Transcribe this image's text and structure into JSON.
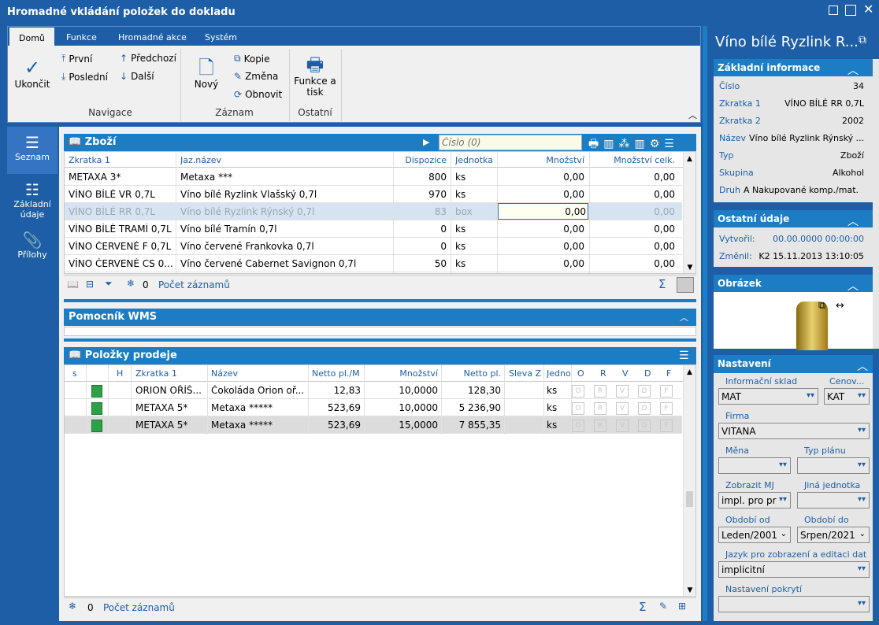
{
  "window": {
    "title": "Hromadné vkládání položek do dokladu"
  },
  "ribbon": {
    "tabs": [
      "Domů",
      "Funkce",
      "Hromadné akce",
      "Systém"
    ],
    "ukoncit": "Ukončit",
    "prvni": "První",
    "posledni": "Poslední",
    "predchozi": "Předchozí",
    "dalsi": "Další",
    "novy": "Nový",
    "kopie": "Kopie",
    "zmena": "Změna",
    "obnovit": "Obnovit",
    "funkce_tisk_1": "Funkce a",
    "funkce_tisk_2": "tisk",
    "groups": {
      "navigace": "Navigace",
      "zaznam": "Záznam",
      "ostatni": "Ostatní"
    }
  },
  "sidebar": {
    "items": [
      "Seznam",
      "Základní",
      "údaje",
      "Přílohy"
    ]
  },
  "zbozi": {
    "title": "Zboží",
    "search_placeholder": "Číslo (0)",
    "headers": [
      "Zkratka 1",
      "Jaz.název",
      "Dispozice",
      "Jednotka",
      "Množství",
      "Množství celk."
    ],
    "rows": [
      [
        "METAXA 3*",
        "Metaxa ***",
        "800",
        "ks",
        "0,00",
        "0,00"
      ],
      [
        "VÍNO BÍLÉ VR 0,7L",
        "Víno bílé Ryzlink Vlašský 0,7l",
        "970",
        "ks",
        "0,00",
        "0,00"
      ],
      [
        "VÍNO BÍLÉ RR 0,7L",
        "Víno bílé Ryzlink Rýnský 0,7l",
        "83",
        "box",
        "0,00",
        "0,00"
      ],
      [
        "VÍNO BÍLÉ TRAMÍ 0,7L",
        "Víno bílé Tramín 0,7l",
        "0",
        "ks",
        "0,00",
        "0,00"
      ],
      [
        "VÍNO ČERVENÉ F 0,7L",
        "Víno červené Frankovka 0,7l",
        "0",
        "ks",
        "0,00",
        "0,00"
      ],
      [
        "VÍNO ČERVENÉ CS 0...",
        "Víno červené Cabernet Savignon 0,7l",
        "50",
        "ks",
        "0,00",
        "0,00"
      ]
    ],
    "status_count": "0",
    "status_label": "Počet záznamů"
  },
  "wms": {
    "title": "Pomocník WMS"
  },
  "polozky": {
    "title": "Položky prodeje",
    "headers": [
      "s",
      "",
      "H",
      "Zkratka 1",
      "Název",
      "Netto pl./M",
      "Množství",
      "Netto pl.",
      "Sleva Z",
      "Jedno",
      "O",
      "R",
      "V",
      "D",
      "F"
    ],
    "rows": [
      [
        "ORION OŘÍŠ...",
        "Čokoláda Orion oř...",
        "12,83",
        "10,0000",
        "128,30",
        "ks"
      ],
      [
        "METAXA 5*",
        "Metaxa *****",
        "523,69",
        "10,0000",
        "5 236,90",
        "ks"
      ],
      [
        "METAXA 5*",
        "Metaxa *****",
        "523,69",
        "15,0000",
        "7 855,35",
        "ks"
      ]
    ],
    "flags": [
      "O",
      "R",
      "V",
      "D",
      "F"
    ],
    "status_count": "0",
    "status_label": "Počet záznamů"
  },
  "detail": {
    "title": "Víno bílé Ryzlink R...",
    "zakladni": {
      "title": "Základní informace",
      "rows": [
        {
          "label": "Číslo",
          "value": "34"
        },
        {
          "label": "Zkratka 1",
          "value": "VÍNO BÍLÉ RR 0,7L"
        },
        {
          "label": "Zkratka 2",
          "value": "2002"
        },
        {
          "label": "Název",
          "value": "Víno bílé Ryzlink Rýnský ..."
        },
        {
          "label": "Typ",
          "value": "Zboží"
        },
        {
          "label": "Skupina",
          "value": "Alkohol"
        },
        {
          "label": "Druh",
          "value": "A Nakupované komp./mat."
        }
      ]
    },
    "ostatni": {
      "title": "Ostatní údaje",
      "vytvoril_label": "Vytvořil:",
      "vytvoril_value": "00.00.0000 00:00:00",
      "zmenil_label": "Změnil:",
      "zmenil_value": "K2 15.11.2013 13:10:05"
    },
    "obrazek": {
      "title": "Obrázek"
    },
    "nastaveni": {
      "title": "Nastavení",
      "informacni_sklad_label": "Informační sklad",
      "informacni_sklad": "MAT",
      "cenova_label": "Cenov...",
      "cenova": "KAT",
      "firma_label": "Firma",
      "firma": "VITANA",
      "mena_label": "Měna",
      "mena": "",
      "typ_planu_label": "Typ plánu",
      "typ_planu": "",
      "zobrazit_mj_label": "Zobrazit MJ",
      "zobrazit_mj": "impl. pro pr",
      "jina_jednotka_label": "Jiná jednotka",
      "jina_jednotka": "",
      "obdobi_od_label": "Období od",
      "obdobi_od": "Leden/2001",
      "obdobi_do_label": "Období do",
      "obdobi_do": "Srpen/2021",
      "jazyk_label": "Jazyk pro zobrazení a editaci dat",
      "jazyk": "implicitní",
      "pokryti_label": "Nastavení pokrytí",
      "pokryti": ""
    }
  }
}
